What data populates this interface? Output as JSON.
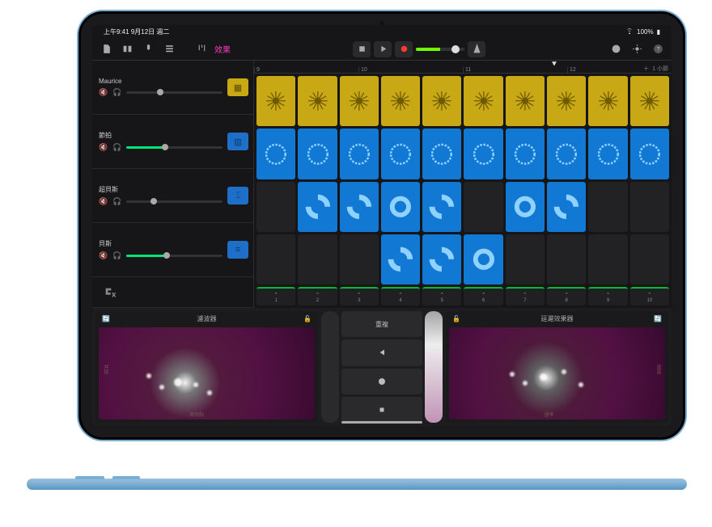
{
  "status": {
    "time": "上午9:41",
    "date": "9月12日 週二",
    "battery": "100%"
  },
  "toolbar": {
    "effects_label": "效果"
  },
  "ruler": {
    "points": [
      "9",
      "10",
      "11",
      "12"
    ],
    "add": "＋",
    "unit": "1 小節"
  },
  "tracks": [
    {
      "name": "Maurice",
      "color": "yellow",
      "vol": 35,
      "icon": "drum"
    },
    {
      "name": "節拍",
      "color": "blue",
      "vol": 40,
      "icon": "keys"
    },
    {
      "name": "超貝斯",
      "color": "blue",
      "vol": 28,
      "icon": "synth"
    },
    {
      "name": "貝斯",
      "color": "blue",
      "vol": 42,
      "icon": "bass"
    }
  ],
  "grid": {
    "yellow_row": [
      1,
      1,
      1,
      1,
      1,
      1,
      1,
      1,
      1,
      1
    ],
    "blue_row1": [
      1,
      1,
      1,
      1,
      1,
      1,
      1,
      1,
      1,
      1
    ],
    "row3": [
      0,
      1,
      1,
      1,
      1,
      0,
      1,
      1,
      0,
      0
    ],
    "row4": [
      0,
      0,
      0,
      1,
      1,
      1,
      0,
      0,
      0,
      0
    ]
  },
  "triggers": [
    "1",
    "2",
    "3",
    "4",
    "5",
    "6",
    "7",
    "8",
    "9",
    "10"
  ],
  "pads": {
    "left": {
      "title": "濾波器",
      "xlabel": "高頻點",
      "ylabel": "共振"
    },
    "right": {
      "title": "延遲效果器",
      "xlabel": "速率",
      "ylabel": "混音"
    }
  },
  "center": {
    "labels": [
      "重複",
      "◀",
      "⊚",
      "■"
    ]
  }
}
